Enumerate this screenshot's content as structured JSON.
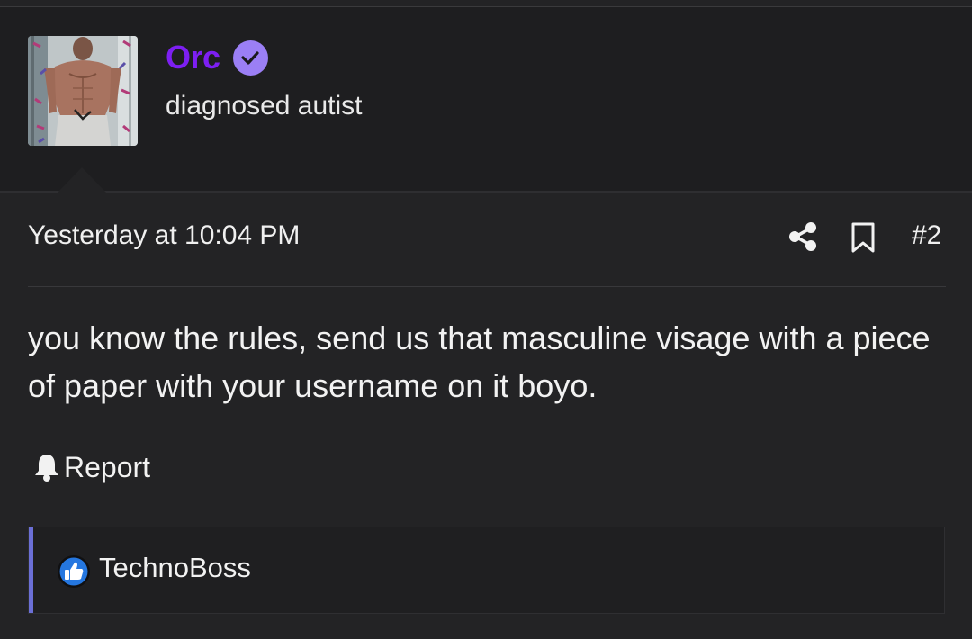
{
  "user": {
    "name": "Orc",
    "title": "diagnosed autist",
    "verified": true,
    "name_color": "#7d1ff2",
    "badge_color": "#9b7ff5"
  },
  "post": {
    "date": "Yesterday at 10:04 PM",
    "number": "#2",
    "body": "you know the rules, send us that masculine visage with a piece of paper with your username on it boyo.",
    "actions": {
      "share_icon": "share-icon",
      "bookmark_icon": "bookmark-icon",
      "report_label": "Report",
      "report_icon": "bell-icon"
    }
  },
  "reactions": {
    "icon": "thumbs-up-icon",
    "users": "TechnoBoss",
    "accent_color": "#6b6fd6",
    "icon_color": "#2577e0"
  }
}
